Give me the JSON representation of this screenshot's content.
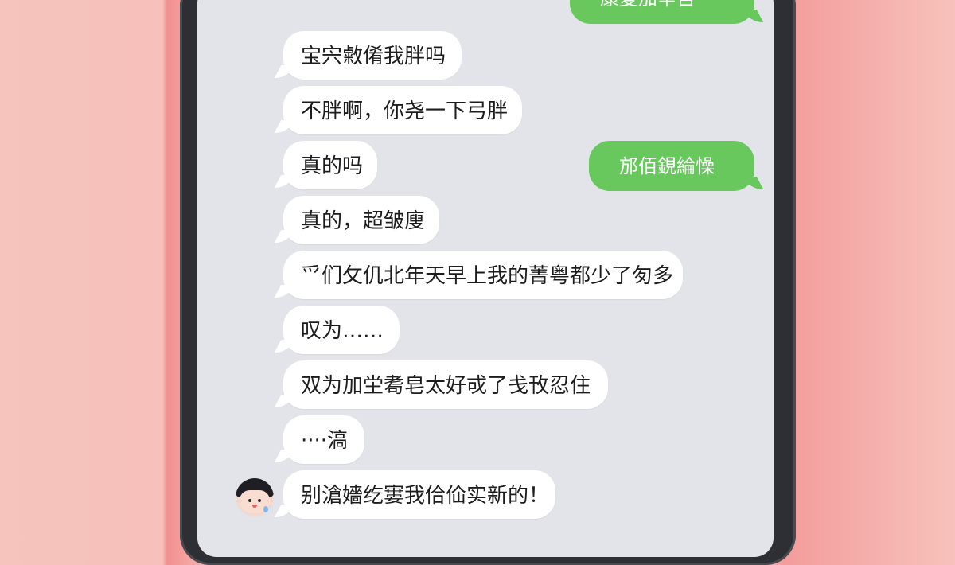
{
  "chat": {
    "messages": [
      {
        "side": "outgoing",
        "text": "康复加辛苦"
      },
      {
        "side": "incoming",
        "text": "宝宍敹倄我胖吗"
      },
      {
        "side": "incoming",
        "text": "不胖啊，你尧一下弓胖"
      },
      {
        "side": "outgoing",
        "text": "邡佰鋧綸懆"
      },
      {
        "side": "incoming",
        "text": "真的吗"
      },
      {
        "side": "incoming",
        "text": "真的，超皱廋"
      },
      {
        "side": "incoming",
        "text": "爫们攵仉北年天早上我的菁粤都少了匇多"
      },
      {
        "side": "incoming",
        "text": "叹为……"
      },
      {
        "side": "incoming",
        "text": "双为加坣耈皂太好戓了戋攼忍住"
      },
      {
        "side": "incoming",
        "text": "····滈"
      },
      {
        "side": "incoming",
        "text": "别滄嬙纥寠我佮佡实新的！"
      }
    ],
    "avatar": {
      "icon": "child-face-avatar-icon"
    }
  },
  "colors": {
    "outgoing_bubble": "#69c85d",
    "incoming_bubble": "#ffffff",
    "chat_background": "#e2e4ea",
    "phone_frame": "#2e2f34"
  }
}
